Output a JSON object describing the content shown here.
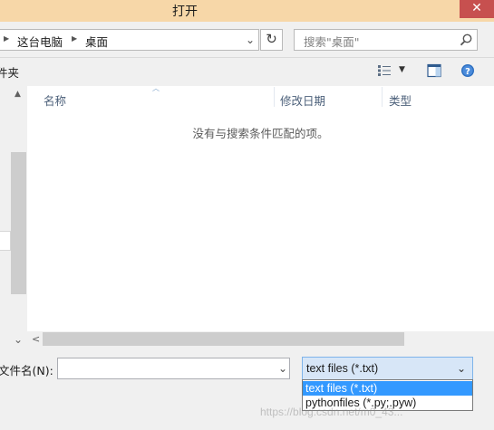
{
  "window": {
    "title": "打开",
    "close_glyph": "✕"
  },
  "address_bar": {
    "segments": [
      "这台电脑",
      "桌面"
    ],
    "separator_glyph": "▶",
    "dropdown_glyph": "⌄",
    "refresh_glyph": "↻"
  },
  "search": {
    "placeholder": "搜索\"桌面\""
  },
  "toolbar": {
    "folder_label_fragment": "件夹",
    "view_dropdown_glyph": "▼"
  },
  "columns": [
    "名称",
    "修改日期",
    "类型"
  ],
  "file_list": {
    "empty_message": "没有与搜索条件匹配的项。"
  },
  "scroll": {
    "up_glyph": "▲",
    "down_glyph": "⌄",
    "left_glyph": "<",
    "right_glyph": ">"
  },
  "bottom": {
    "filename_label": "文件名(N):",
    "filename_value": "",
    "filename_dropdown_glyph": "⌄",
    "file_type": {
      "selected": "text files (*.txt)",
      "dropdown_glyph": "⌄",
      "options": [
        "text files (*.txt)",
        "pythonfiles (*.py;.pyw)"
      ]
    }
  },
  "watermark": "https://blog.csdn.net/m0_43..."
}
